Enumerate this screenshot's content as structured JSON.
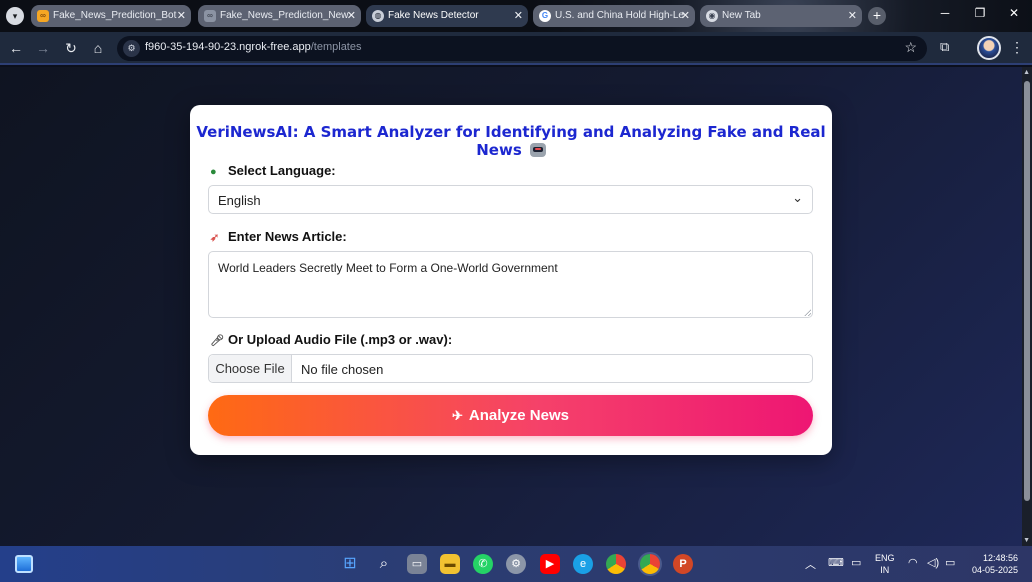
{
  "browser": {
    "tabs": [
      {
        "label": "Fake_News_Prediction_Bot",
        "favicon": "colab-icon",
        "active": false
      },
      {
        "label": "Fake_News_Prediction_New",
        "favicon": "colab-icon",
        "active": false
      },
      {
        "label": "Fake News Detector",
        "favicon": "globe-icon",
        "active": true
      },
      {
        "label": "U.S. and China Hold High-Le",
        "favicon": "google-icon",
        "active": false
      },
      {
        "label": "New Tab",
        "favicon": "chrome-icon",
        "active": false
      }
    ],
    "url_host": "f960-35-194-90-23.ngrok-free.app",
    "url_path": "/templates"
  },
  "form": {
    "title": "VeriNewsAI: A Smart Analyzer for Identifying and Analyzing Fake and Real News",
    "language_label": "Select Language:",
    "language_value": "English",
    "article_label": "Enter News Article:",
    "article_value": "World Leaders Secretly Meet to Form a One-World Government",
    "audio_label": "Or Upload Audio File (.mp3 or .wav):",
    "choose_file_label": "Choose File",
    "no_file_text": "No file chosen",
    "analyze_label": "Analyze News",
    "colors": {
      "title": "#1c27d0",
      "button_start": "#ff6a13",
      "button_end": "#ee1673"
    }
  },
  "taskbar": {
    "language": "ENG",
    "region": "IN",
    "time": "12:48:56",
    "date": "04-05-2025"
  }
}
